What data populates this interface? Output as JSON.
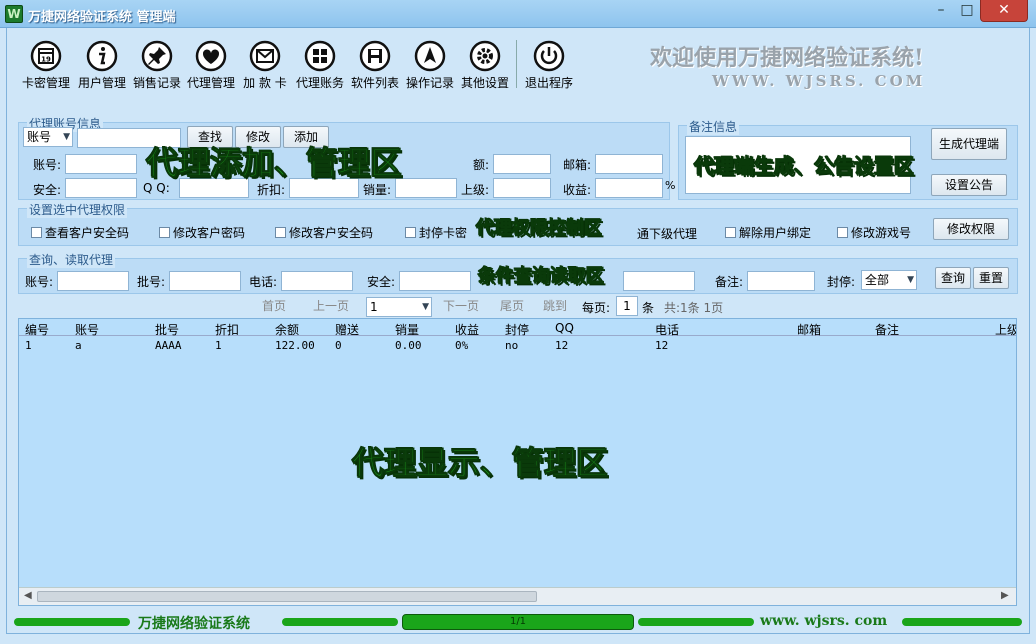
{
  "window": {
    "title": "万捷网络验证系统 管理端",
    "icon_letter": "W",
    "min": "–",
    "max": "□",
    "close": "✕"
  },
  "toolbar": {
    "items": [
      {
        "label": "卡密管理",
        "icon": "calendar-icon"
      },
      {
        "label": "用户管理",
        "icon": "info-icon"
      },
      {
        "label": "销售记录",
        "icon": "pin-icon"
      },
      {
        "label": "代理管理",
        "icon": "heart-icon"
      },
      {
        "label": "加 款 卡",
        "icon": "mail-icon"
      },
      {
        "label": "代理账务",
        "icon": "windows-icon"
      },
      {
        "label": "软件列表",
        "icon": "save-icon"
      },
      {
        "label": "操作记录",
        "icon": "navigate-icon"
      },
      {
        "label": "其他设置",
        "icon": "gear-icon"
      },
      {
        "label": "退出程序",
        "icon": "power-icon"
      }
    ]
  },
  "banner": {
    "welcome": "欢迎使用万捷网络验证系统!",
    "url": "WWW. WJSRS. COM"
  },
  "agent_info": {
    "title": "代理账号信息",
    "account_type": "账号",
    "search_btn": "查找",
    "modify_btn": "修改",
    "add_btn": "添加",
    "labels": {
      "account": "账号:",
      "security": "安全:",
      "qq": "Q  Q:",
      "discount": "折扣:",
      "balance": "额:",
      "sales": "销量:",
      "superior": "上级:",
      "email": "邮箱:",
      "income": "收益:",
      "percent": "%"
    }
  },
  "notes": {
    "title": "备注信息",
    "generate_btn": "生成代理端",
    "announce_btn": "设置公告"
  },
  "permissions": {
    "title": "设置选中代理权限",
    "items": [
      "查看客户安全码",
      "修改客户密码",
      "修改客户安全码",
      "封停卡密",
      "通下级代理",
      "解除用户绑定",
      "修改游戏号"
    ],
    "modify_btn": "修改权限"
  },
  "query": {
    "title": "查询、读取代理",
    "labels": {
      "account": "账号:",
      "batch": "批号:",
      "phone": "电话:",
      "security": "安全:",
      "note": "备注:",
      "ban": "封停:"
    },
    "ban_value": "全部",
    "query_btn": "查询",
    "reset_btn": "重置"
  },
  "pager": {
    "first": "首页",
    "prev": "上一页",
    "page_select": "1",
    "next": "下一页",
    "last": "尾页",
    "jump": "跳到",
    "per_page_label": "每页:",
    "per_page_value": "1",
    "unit": "条",
    "summary": "共:1条 1页"
  },
  "grid": {
    "columns": [
      "编号",
      "账号",
      "批号",
      "折扣",
      "余额",
      "赠送",
      "销量",
      "收益",
      "封停",
      "QQ",
      "电话",
      "邮箱",
      "备注",
      "上级"
    ],
    "rows": [
      [
        "1",
        "a",
        "AAAA",
        "1",
        "122.00",
        "0",
        "0.00",
        "0%",
        "no",
        "12",
        "12",
        "",
        "",
        ""
      ]
    ]
  },
  "annotations": {
    "agent_add": "代理添加、管理区",
    "notes_area": "代理端生成、公告设置区",
    "permission_area": "代理权限控制区",
    "query_area": "条件查询读取区",
    "grid_area": "代理显示、管理区"
  },
  "status": {
    "left": "万捷网络验证系统",
    "page": "1/1",
    "right": "www. wjsrs. com"
  }
}
